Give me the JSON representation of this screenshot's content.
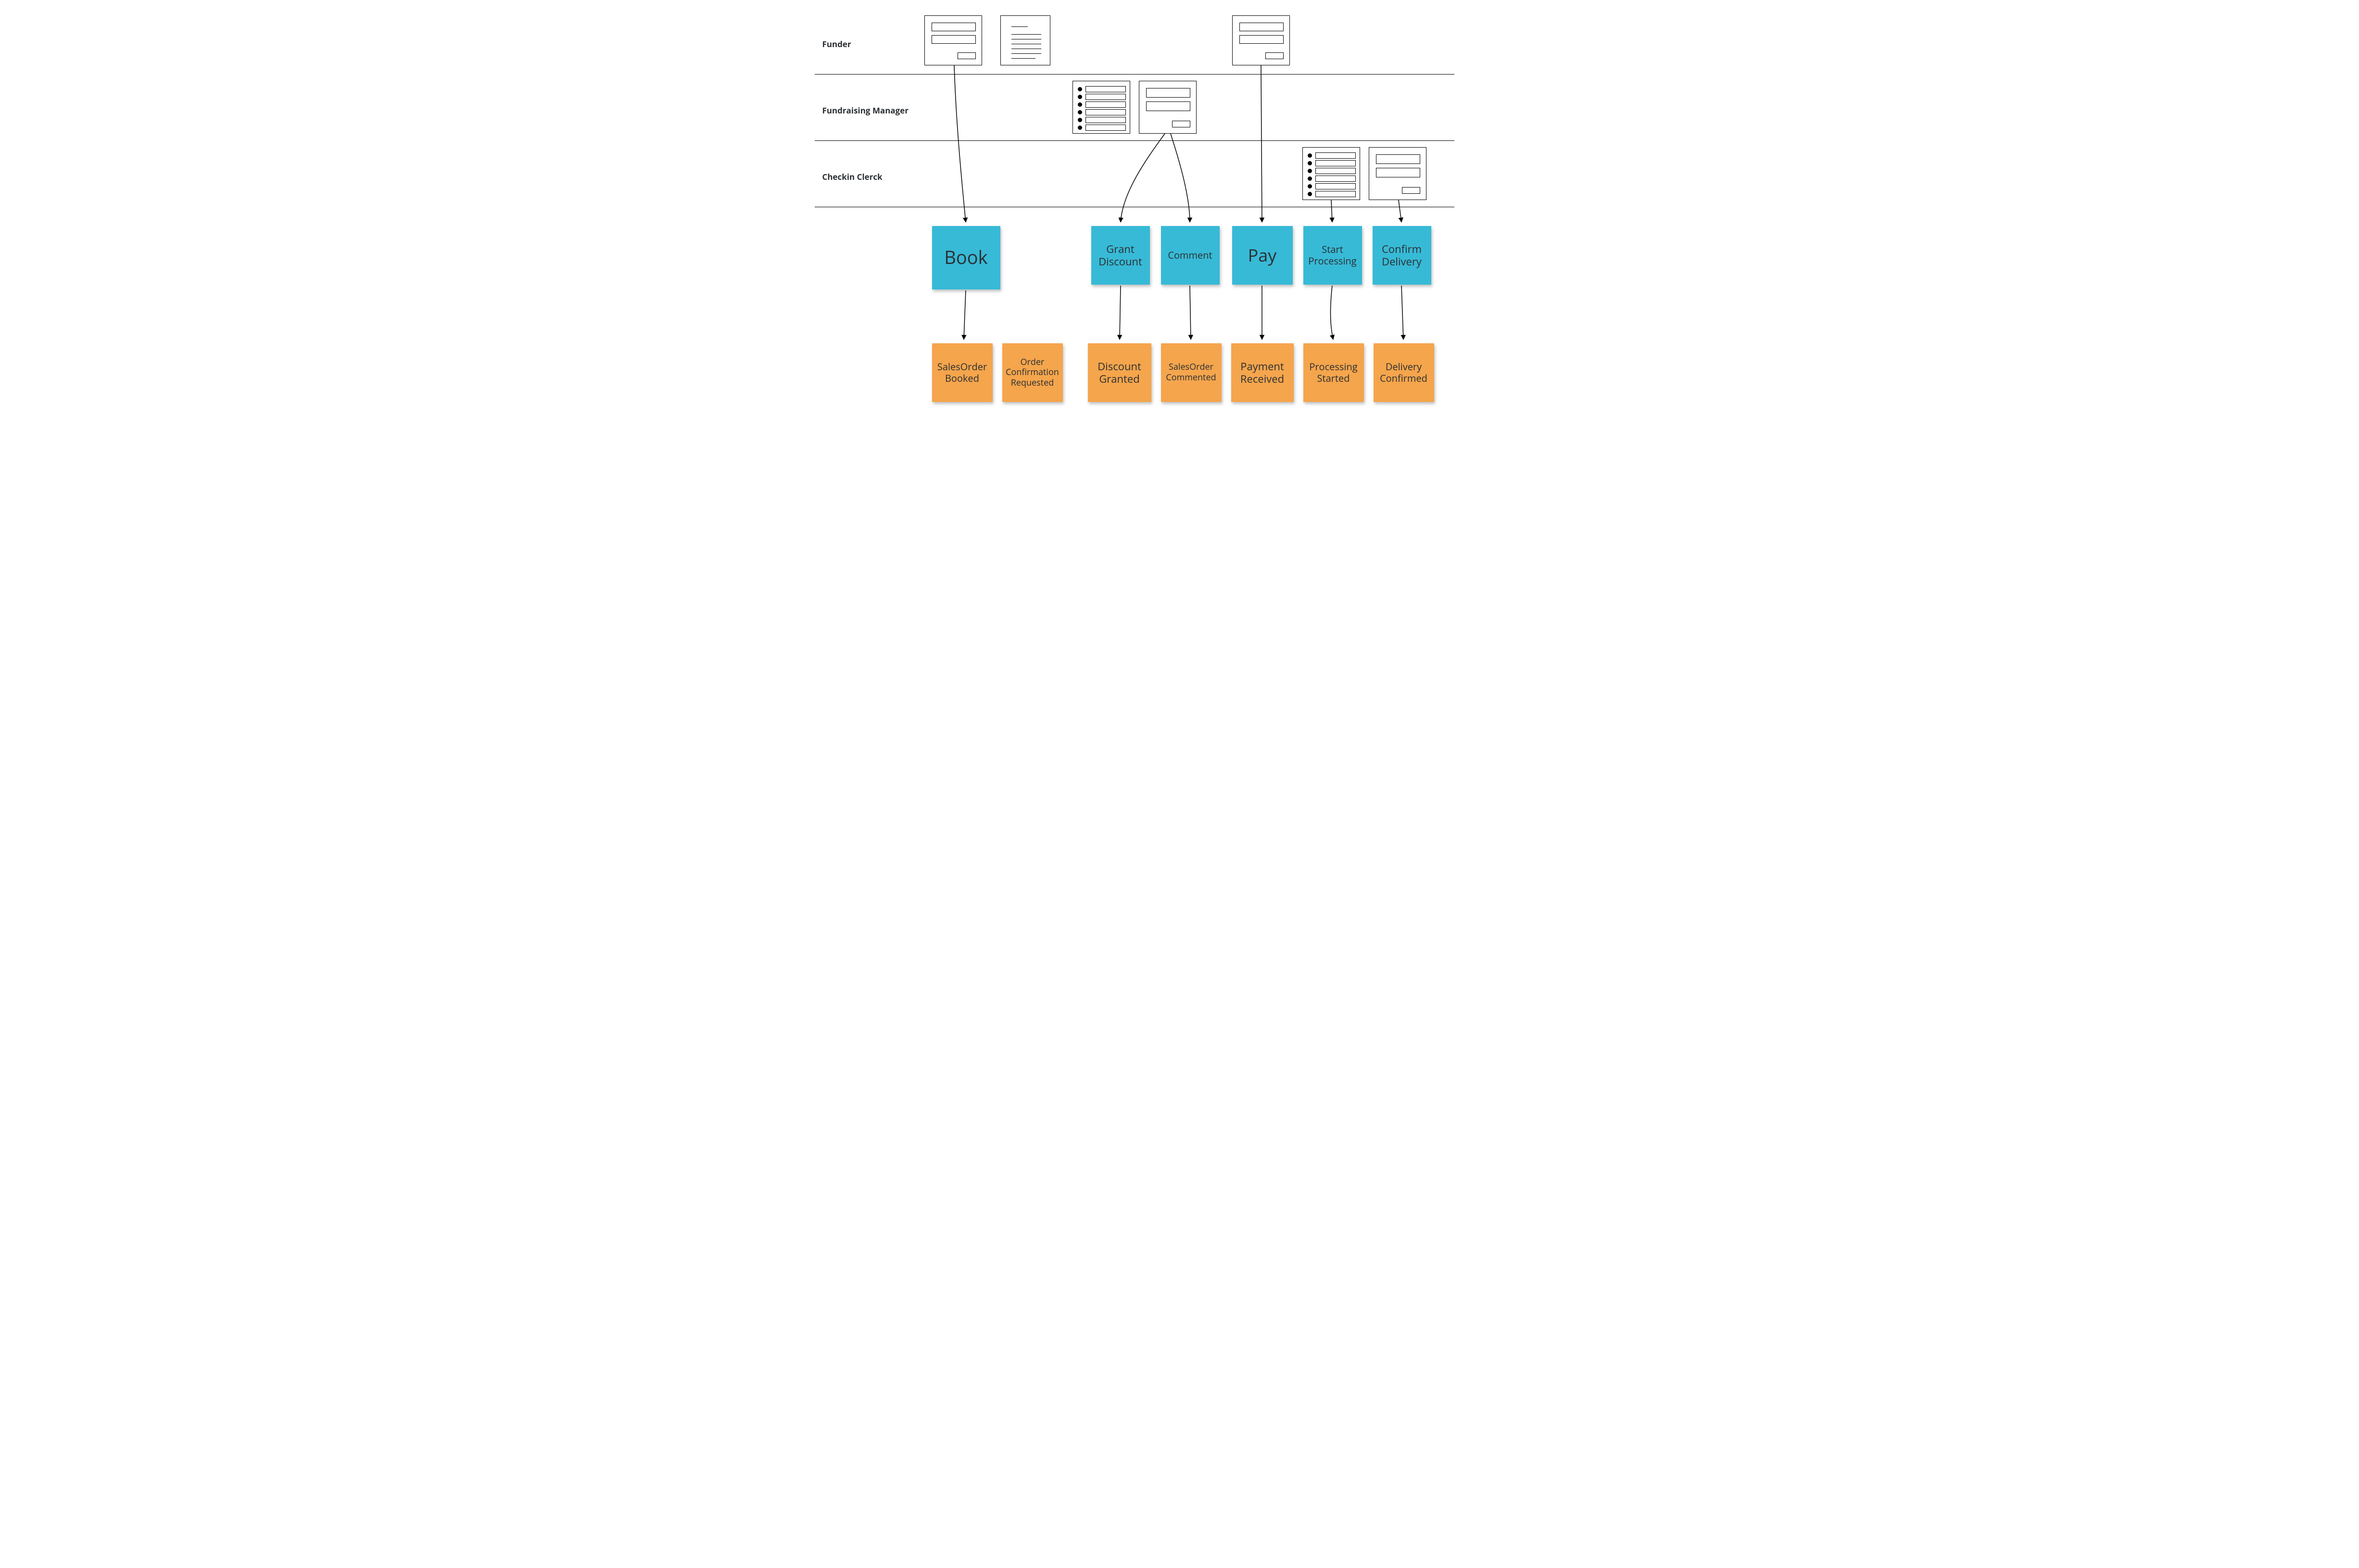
{
  "lanes": {
    "r0": "Funder",
    "r1": "Fundraising Manager",
    "r2": "Checkin Clerck"
  },
  "commands": {
    "c0": "Book",
    "c1": "Grant Discount",
    "c2": "Comment",
    "c3": "Pay",
    "c4": "Start Processing",
    "c5": "Confirm Delivery"
  },
  "events": {
    "e0": "SalesOrder Booked",
    "e1": "Order Confirmation Requested",
    "e2": "Discount Granted",
    "e3": "SalesOrder Commented",
    "e4": "Payment Received",
    "e5": "Processing Started",
    "e6": "Delivery Confirmed"
  },
  "colors": {
    "command": "#37bad6",
    "event": "#f5a54c"
  }
}
